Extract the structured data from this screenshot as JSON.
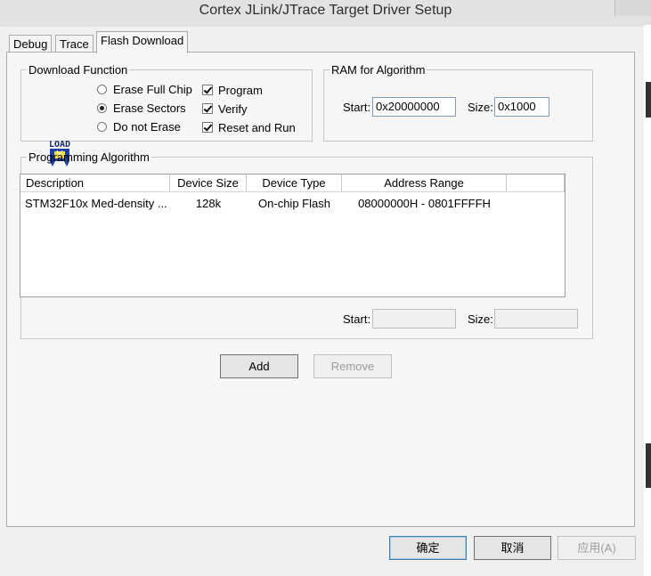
{
  "window": {
    "title": "Cortex JLink/JTrace Target Driver Setup"
  },
  "tabs": [
    {
      "label": "Debug",
      "active": false
    },
    {
      "label": "Trace",
      "active": false
    },
    {
      "label": "Flash Download",
      "active": true
    }
  ],
  "download_function": {
    "legend": "Download Function",
    "radios": [
      {
        "label": "Erase Full Chip",
        "checked": false
      },
      {
        "label": "Erase Sectors",
        "checked": true
      },
      {
        "label": "Do not Erase",
        "checked": false
      }
    ],
    "checks": [
      {
        "label": "Program",
        "checked": true
      },
      {
        "label": "Verify",
        "checked": true
      },
      {
        "label": "Reset and Run",
        "checked": true
      }
    ],
    "icon": "load-icon",
    "icon_text": "LOAD"
  },
  "ram": {
    "legend": "RAM for Algorithm",
    "start_label": "Start:",
    "start_value": "0x20000000",
    "size_label": "Size:",
    "size_value": "0x1000"
  },
  "programming": {
    "legend": "Programming Algorithm",
    "columns": [
      "Description",
      "Device Size",
      "Device Type",
      "Address Range"
    ],
    "rows": [
      {
        "description": "STM32F10x Med-density ...",
        "size": "128k",
        "type": "On-chip Flash",
        "range": "08000000H - 0801FFFFH"
      }
    ],
    "start_label": "Start:",
    "start_value": "",
    "size_label": "Size:",
    "size_value": ""
  },
  "buttons": {
    "add": "Add",
    "remove": "Remove",
    "ok": "确定",
    "cancel": "取消",
    "apply": "应用(A)"
  }
}
